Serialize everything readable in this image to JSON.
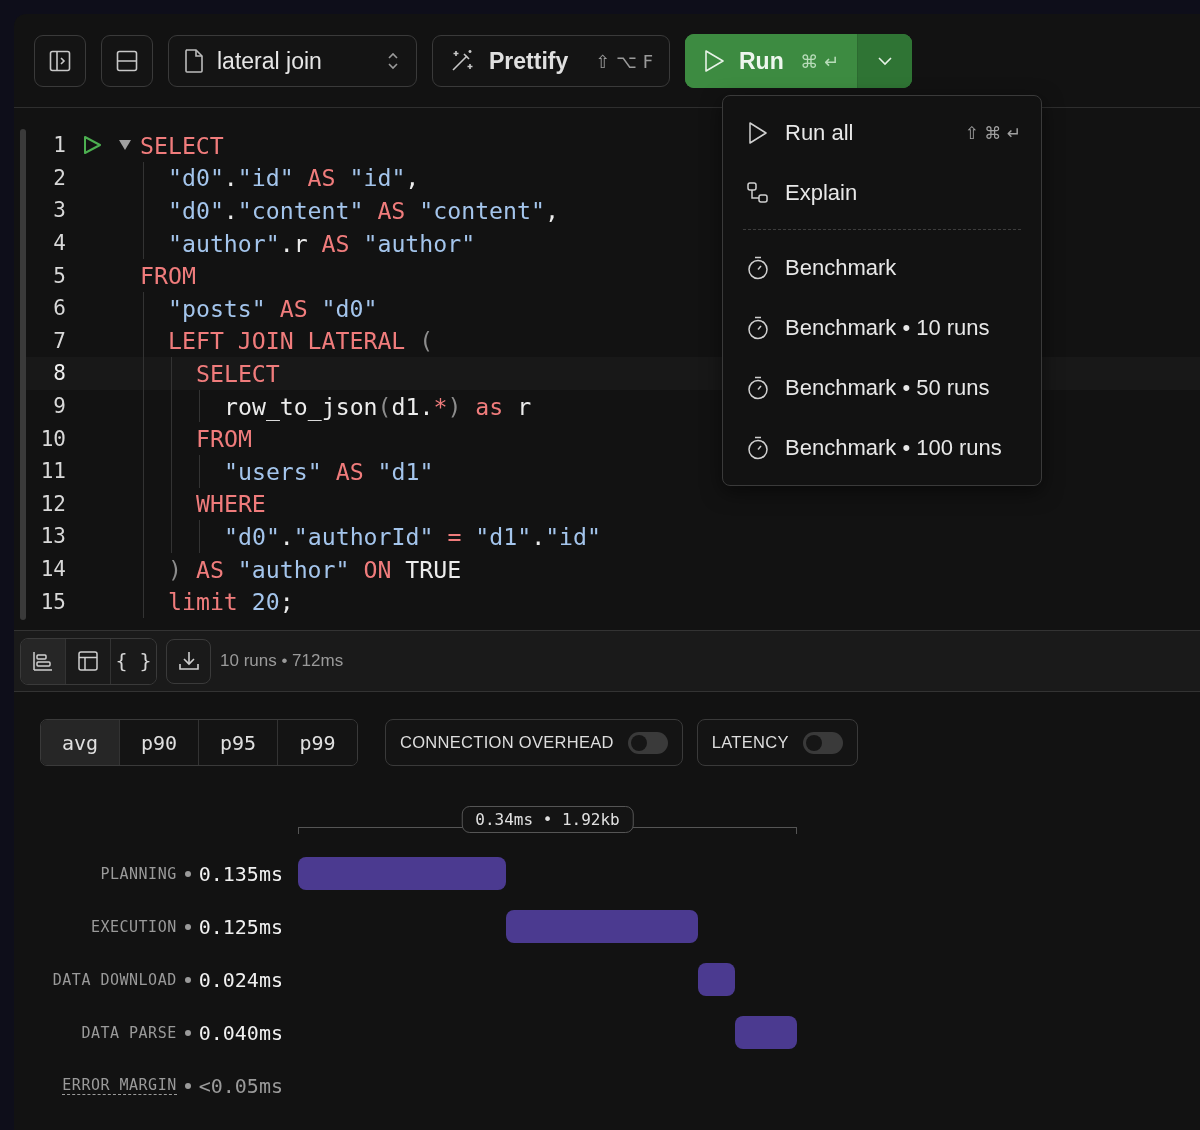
{
  "toolbar": {
    "file_name": "lateral join",
    "prettify": {
      "label": "Prettify",
      "shortcut": "⇧ ⌥ F"
    },
    "run": {
      "label": "Run",
      "shortcut": "⌘ ↵",
      "menu_open": true
    }
  },
  "editor": {
    "lines": [
      {
        "number": "1",
        "current": false,
        "runnable": true,
        "foldable": true,
        "tokens": [
          {
            "kind": "kw",
            "text": "SELECT"
          }
        ],
        "children": [
          {
            "number": "2",
            "current": false,
            "runnable": false,
            "foldable": false,
            "tokens": [
              {
                "kind": "str",
                "text": "\"d0\""
              },
              {
                "kind": "plain",
                "text": "."
              },
              {
                "kind": "str",
                "text": "\"id\""
              },
              {
                "kind": "kw",
                "text": " AS"
              },
              {
                "kind": "str",
                "text": " \"id\""
              },
              {
                "kind": "plain",
                "text": ","
              }
            ]
          },
          {
            "number": "3",
            "current": false,
            "runnable": false,
            "foldable": false,
            "tokens": [
              {
                "kind": "str",
                "text": "\"d0\""
              },
              {
                "kind": "plain",
                "text": "."
              },
              {
                "kind": "str",
                "text": "\"content\""
              },
              {
                "kind": "kw",
                "text": " AS"
              },
              {
                "kind": "str",
                "text": " \"content\""
              },
              {
                "kind": "plain",
                "text": ","
              }
            ]
          },
          {
            "number": "4",
            "current": false,
            "runnable": false,
            "foldable": false,
            "tokens": [
              {
                "kind": "str",
                "text": "\"author\""
              },
              {
                "kind": "plain",
                "text": ".r"
              },
              {
                "kind": "kw",
                "text": " AS"
              },
              {
                "kind": "str",
                "text": " \"author\""
              }
            ]
          }
        ]
      },
      {
        "number": "5",
        "current": false,
        "runnable": false,
        "foldable": false,
        "tokens": [
          {
            "kind": "kw",
            "text": "FROM"
          }
        ],
        "children": [
          {
            "number": "6",
            "current": false,
            "runnable": false,
            "foldable": false,
            "tokens": [
              {
                "kind": "str",
                "text": "\"posts\""
              },
              {
                "kind": "kw",
                "text": " AS"
              },
              {
                "kind": "str",
                "text": " \"d0\""
              }
            ]
          },
          {
            "number": "7",
            "current": false,
            "runnable": false,
            "foldable": false,
            "tokens": [
              {
                "kind": "kw",
                "text": "LEFT JOIN LATERAL"
              },
              {
                "kind": "punct",
                "text": " ("
              }
            ],
            "children": [
              {
                "number": "8",
                "current": true,
                "runnable": false,
                "foldable": false,
                "tokens": [
                  {
                    "kind": "kw",
                    "text": "SELECT"
                  }
                ],
                "children": [
                  {
                    "number": "9",
                    "current": false,
                    "runnable": false,
                    "foldable": false,
                    "tokens": [
                      {
                        "kind": "plain",
                        "text": "row_to_json"
                      },
                      {
                        "kind": "punct",
                        "text": "("
                      },
                      {
                        "kind": "plain",
                        "text": "d1."
                      },
                      {
                        "kind": "kw",
                        "text": "*"
                      },
                      {
                        "kind": "punct",
                        "text": ")"
                      },
                      {
                        "kind": "kw",
                        "text": " as"
                      },
                      {
                        "kind": "plain",
                        "text": " r"
                      }
                    ]
                  }
                ]
              },
              {
                "number": "10",
                "current": false,
                "runnable": false,
                "foldable": false,
                "tokens": [
                  {
                    "kind": "kw",
                    "text": "FROM"
                  }
                ],
                "children": [
                  {
                    "number": "11",
                    "current": false,
                    "runnable": false,
                    "foldable": false,
                    "tokens": [
                      {
                        "kind": "str",
                        "text": "\"users\""
                      },
                      {
                        "kind": "kw",
                        "text": " AS"
                      },
                      {
                        "kind": "str",
                        "text": " \"d1\""
                      }
                    ]
                  }
                ]
              },
              {
                "number": "12",
                "current": false,
                "runnable": false,
                "foldable": false,
                "tokens": [
                  {
                    "kind": "kw",
                    "text": "WHERE"
                  }
                ],
                "children": [
                  {
                    "number": "13",
                    "current": false,
                    "runnable": false,
                    "foldable": false,
                    "tokens": [
                      {
                        "kind": "str",
                        "text": "\"d0\""
                      },
                      {
                        "kind": "plain",
                        "text": "."
                      },
                      {
                        "kind": "str",
                        "text": "\"authorId\""
                      },
                      {
                        "kind": "kw",
                        "text": " ="
                      },
                      {
                        "kind": "str",
                        "text": " \"d1\""
                      },
                      {
                        "kind": "plain",
                        "text": "."
                      },
                      {
                        "kind": "str",
                        "text": "\"id\""
                      }
                    ]
                  }
                ]
              }
            ]
          },
          {
            "number": "14",
            "current": false,
            "runnable": false,
            "foldable": false,
            "tokens": [
              {
                "kind": "punct",
                "text": ")"
              },
              {
                "kind": "kw",
                "text": " AS"
              },
              {
                "kind": "str",
                "text": " \"author\""
              },
              {
                "kind": "kw",
                "text": " ON"
              },
              {
                "kind": "plain",
                "text": " TRUE"
              }
            ]
          },
          {
            "number": "15",
            "current": false,
            "runnable": false,
            "foldable": false,
            "tokens": [
              {
                "kind": "kw",
                "text": "limit"
              },
              {
                "kind": "str",
                "text": " 20"
              },
              {
                "kind": "plain",
                "text": ";"
              }
            ]
          }
        ]
      }
    ]
  },
  "run_menu": {
    "items": [
      {
        "kind": "run",
        "label": "Run all",
        "shortcut": "⇧ ⌘ ↵",
        "divider_after": false
      },
      {
        "kind": "explain",
        "label": "Explain",
        "divider_after": true
      },
      {
        "kind": "benchmark",
        "label": "Benchmark",
        "divider_after": false
      },
      {
        "kind": "benchmark",
        "label": "Benchmark • 10 runs",
        "divider_after": false
      },
      {
        "kind": "benchmark",
        "label": "Benchmark • 50 runs",
        "divider_after": false
      },
      {
        "kind": "benchmark",
        "label": "Benchmark • 100 runs",
        "divider_after": false
      }
    ]
  },
  "results_toolbar": {
    "views": [
      {
        "kind": "chart",
        "selected": true
      },
      {
        "kind": "table",
        "selected": false
      },
      {
        "kind": "json",
        "label": "{ }",
        "selected": false
      }
    ],
    "summary": "10 runs • 712ms"
  },
  "benchmark": {
    "percentiles": [
      {
        "label": "avg",
        "selected": true
      },
      {
        "label": "p90",
        "selected": false
      },
      {
        "label": "p95",
        "selected": false
      },
      {
        "label": "p99",
        "selected": false
      }
    ],
    "toggles": [
      {
        "label": "CONNECTION OVERHEAD",
        "on": false
      },
      {
        "label": "LATENCY",
        "on": false
      }
    ],
    "total_label": "0.34ms • 1.92kb",
    "phases": [
      {
        "kind": "bar",
        "label": "PLANNING",
        "value": "0.135ms"
      },
      {
        "kind": "bar",
        "label": "EXECUTION",
        "value": "0.125ms"
      },
      {
        "kind": "bar",
        "label": "DATA DOWNLOAD",
        "value": "0.024ms"
      },
      {
        "kind": "bar",
        "label": "DATA PARSE",
        "value": "0.040ms"
      },
      {
        "kind": "note",
        "label": "ERROR MARGIN",
        "value": "<0.05ms"
      }
    ]
  }
}
